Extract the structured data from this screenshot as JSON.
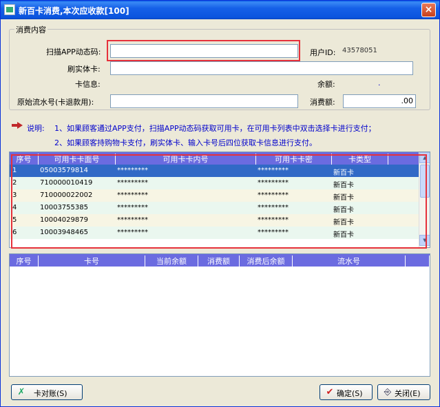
{
  "window": {
    "title": "新百卡消费,本次应收款[100]",
    "close_label": "×"
  },
  "form": {
    "group_label": "消费内容",
    "scan_label": "扫描APP动态码:",
    "scan_value": "",
    "user_id_label": "用户ID:",
    "user_id_value": "43578051",
    "card_label": "刷实体卡:",
    "card_value": "",
    "card_info_label": "卡信息:",
    "balance_label": "余额:",
    "balance_value": ".",
    "serial_label": "原始流水号(卡退款用):",
    "serial_value": "",
    "amount_label": "消费额:",
    "amount_value": ".00"
  },
  "notes": {
    "prefix": "说明:",
    "line1": "1、如果顾客通过APP支付，扫描APP动态码获取可用卡，在可用卡列表中双击选择卡进行支付；",
    "line2": "2、如果顾客持购物卡支付，刷实体卡、输入卡号后四位获取卡信息进行支付。"
  },
  "available_cards": {
    "headers": [
      "序号",
      "可用卡卡面号",
      "可用卡卡内号",
      "可用卡卡密",
      "卡类型"
    ],
    "rows": [
      [
        "1",
        "05003579814",
        "*********",
        "*********",
        "新百卡"
      ],
      [
        "2",
        "710000010419",
        "*********",
        "*********",
        "新百卡"
      ],
      [
        "3",
        "710000022002",
        "*********",
        "*********",
        "新百卡"
      ],
      [
        "4",
        "10003755385",
        "*********",
        "*********",
        "新百卡"
      ],
      [
        "5",
        "10004029879",
        "*********",
        "*********",
        "新百卡"
      ],
      [
        "6",
        "10003948465",
        "*********",
        "*********",
        "新百卡"
      ]
    ],
    "selected_row": 0
  },
  "payments": {
    "headers": [
      "序号",
      "卡号",
      "当前余额",
      "消费额",
      "消费后余额",
      "流水号"
    ],
    "rows": []
  },
  "buttons": {
    "reconcile": "卡对账(S)",
    "confirm": "确定(S)",
    "close": "关闭(E)"
  },
  "colors": {
    "title_bar": "#0b54de",
    "grid_header": "#6b6be0",
    "selected_row": "#3169c6",
    "row_even": "#f7f5e4",
    "row_odd": "#eaf7ef",
    "highlight": "#e6303a",
    "note_text": "#0000cc"
  }
}
